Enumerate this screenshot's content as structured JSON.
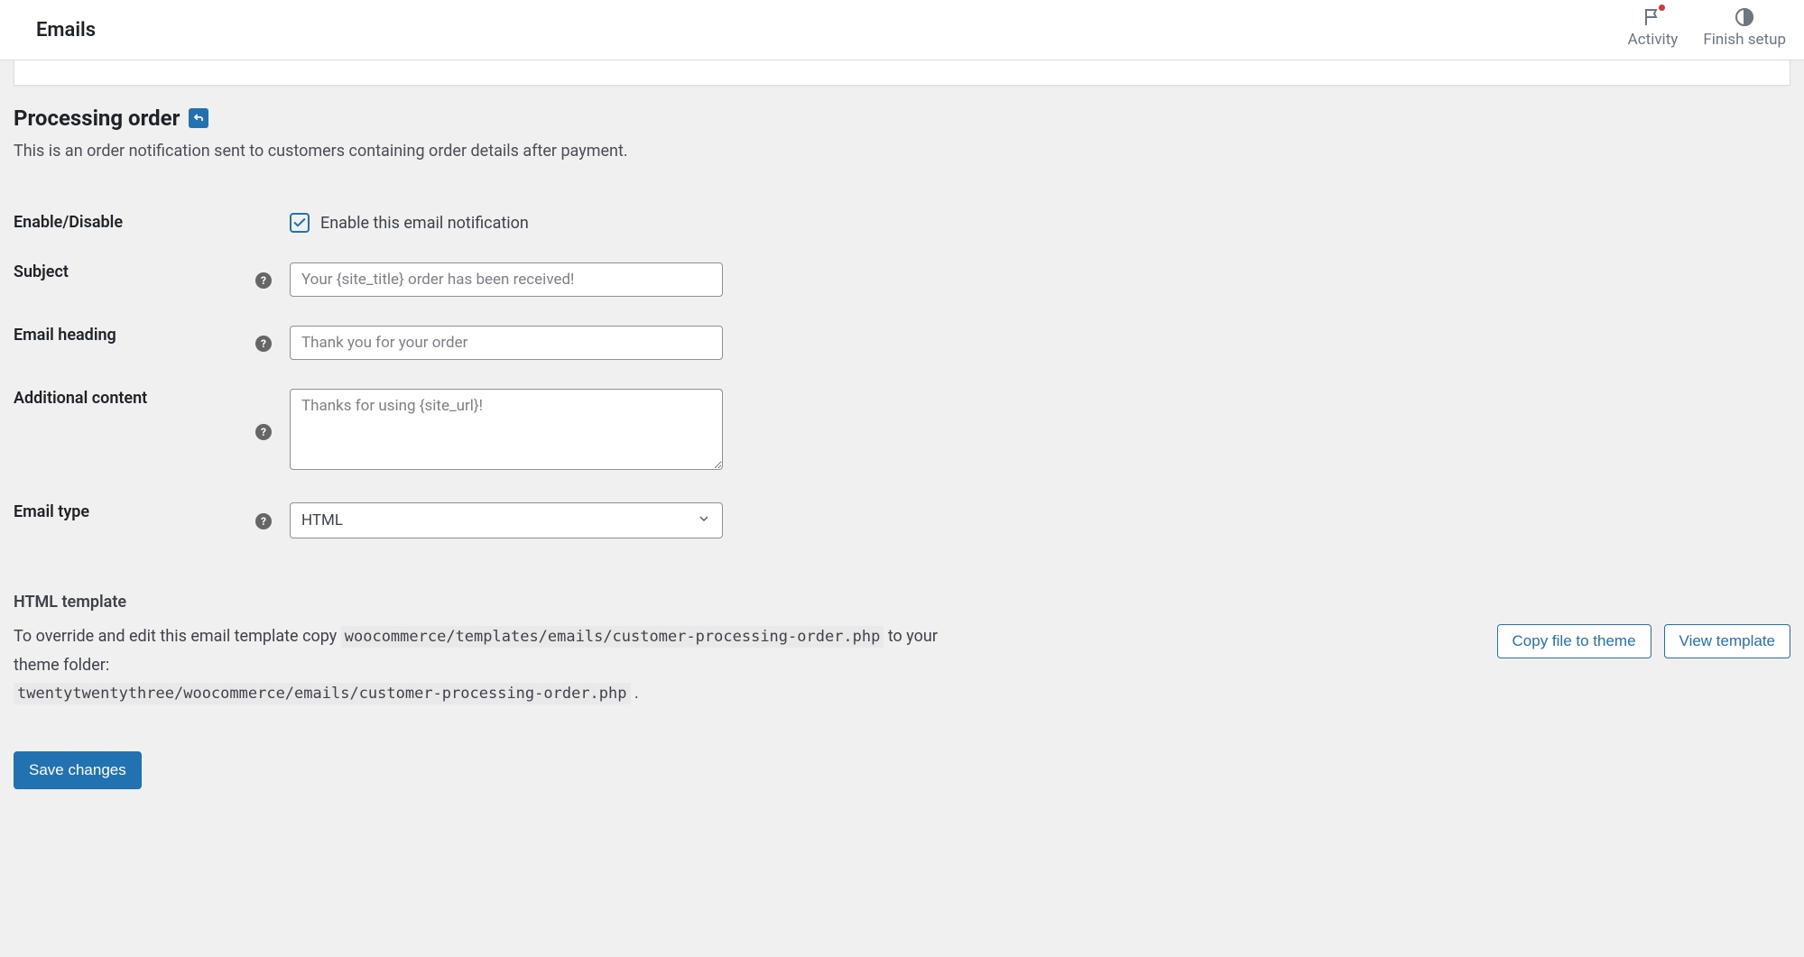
{
  "topbar": {
    "title": "Emails",
    "activity": "Activity",
    "finish_setup": "Finish setup"
  },
  "section": {
    "heading": "Processing order",
    "desc": "This is an order notification sent to customers containing order details after payment."
  },
  "fields": {
    "enable": {
      "label": "Enable/Disable",
      "checkbox_label": "Enable this email notification",
      "checked": true
    },
    "subject": {
      "label": "Subject",
      "placeholder": "Your {site_title} order has been received!",
      "value": ""
    },
    "heading": {
      "label": "Email heading",
      "placeholder": "Thank you for your order",
      "value": ""
    },
    "additional": {
      "label": "Additional content",
      "placeholder": "Thanks for using {site_url}!",
      "value": ""
    },
    "type": {
      "label": "Email type",
      "value": "HTML"
    }
  },
  "template": {
    "heading": "HTML template",
    "intro_a": "To override and edit this email template copy ",
    "path_a": "woocommerce/templates/emails/customer-processing-order.php",
    "intro_b": " to your theme folder: ",
    "path_b": "twentytwentythree/woocommerce/emails/customer-processing-order.php",
    "period": " .",
    "copy_btn": "Copy file to theme",
    "view_btn": "View template"
  },
  "save": "Save changes",
  "help_glyph": "?"
}
